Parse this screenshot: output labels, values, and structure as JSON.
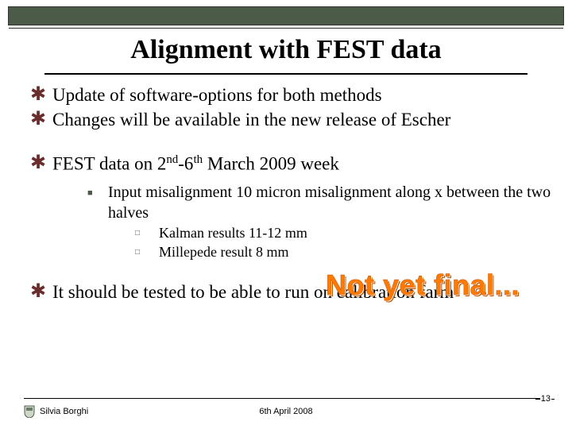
{
  "title": "Alignment with FEST data",
  "bullets": {
    "b1": "Update of software-options for both methods",
    "b2": "Changes will be available in the new release of Escher",
    "b3_pre": "FEST data on 2",
    "b3_sup1": "nd",
    "b3_mid": "-6",
    "b3_sup2": "th",
    "b3_post": " March 2009 week",
    "b3a": "Input misalignment 10 micron misalignment along x between the two halves",
    "b3a1": "Kalman results 11-12 ",
    "b3a1_unit": "mm",
    "b3a2": "Millepede result 8 ",
    "b3a2_unit": "mm",
    "b4": "It should be tested to be able to run on calibration farm"
  },
  "stamp": "Not yet final...",
  "footer": {
    "author": "Silvia Borghi",
    "date": "6th April 2008",
    "page": "13"
  }
}
